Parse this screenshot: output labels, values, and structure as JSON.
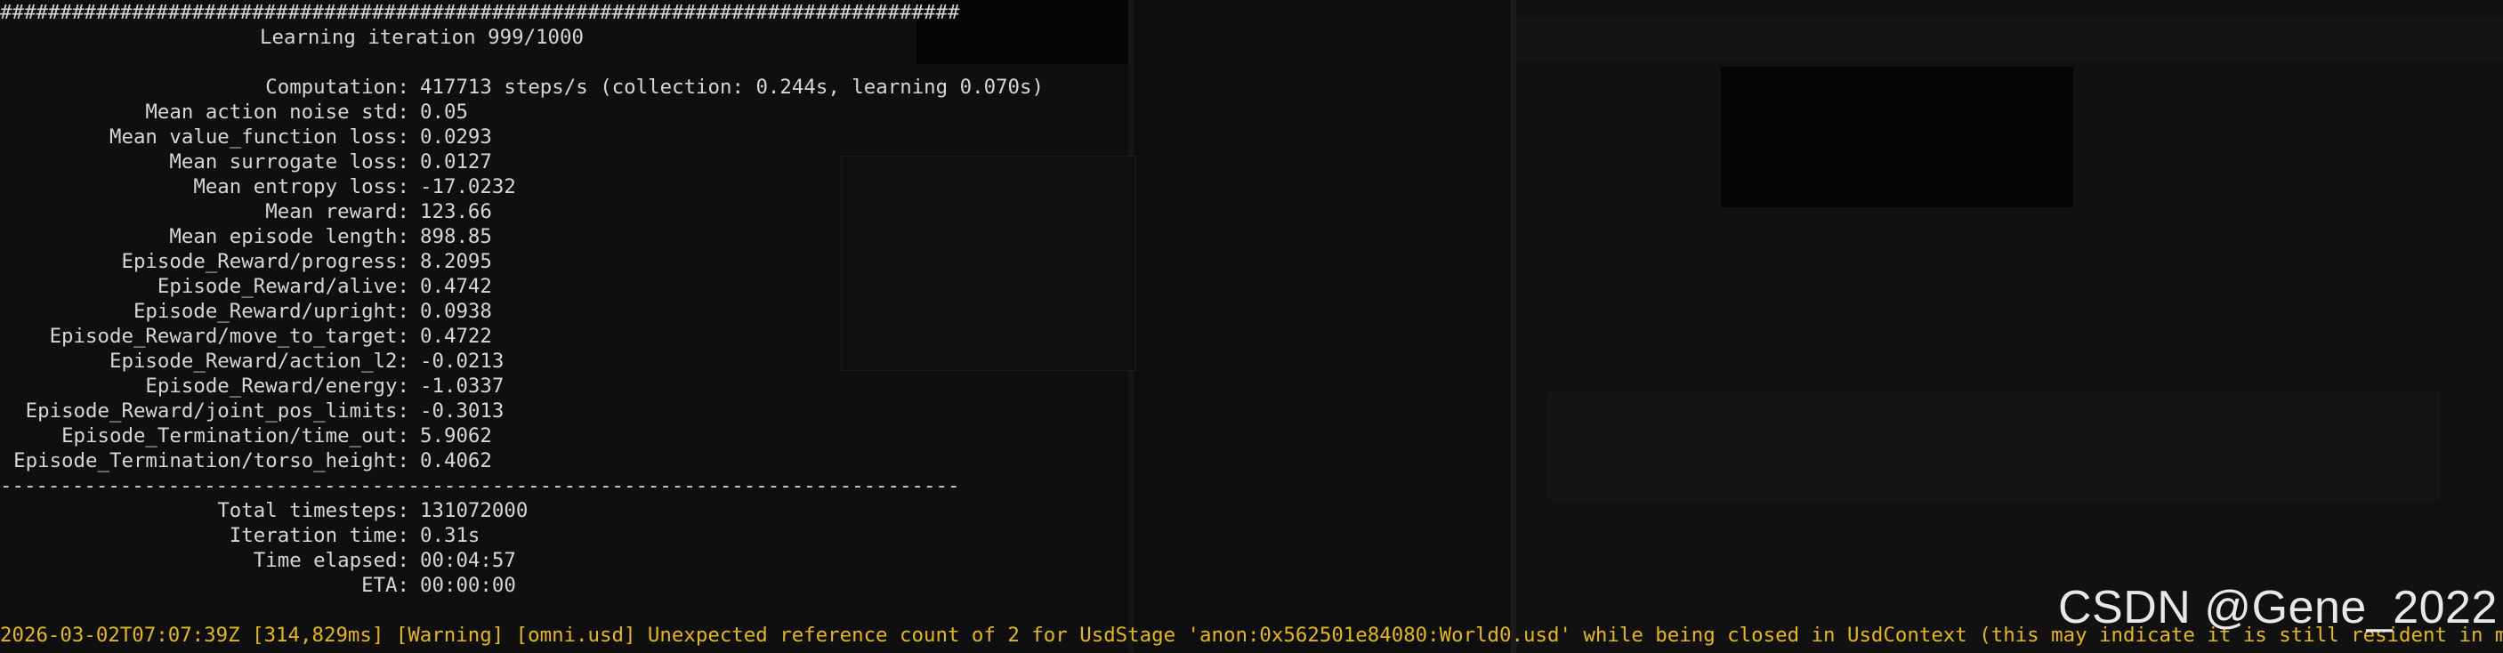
{
  "terminal": {
    "hash_rule": "################################################################################",
    "iteration_header": "Learning iteration 999/1000",
    "metrics": [
      {
        "key": "Computation:",
        "value": "417713 steps/s (collection: 0.244s, learning 0.070s)"
      },
      {
        "key": "Mean action noise std:",
        "value": "0.05"
      },
      {
        "key": "Mean value_function loss:",
        "value": "0.0293"
      },
      {
        "key": "Mean surrogate loss:",
        "value": "0.0127"
      },
      {
        "key": "Mean entropy loss:",
        "value": "-17.0232"
      },
      {
        "key": "Mean reward:",
        "value": "123.66"
      },
      {
        "key": "Mean episode length:",
        "value": "898.85"
      },
      {
        "key": "Episode_Reward/progress:",
        "value": "8.2095"
      },
      {
        "key": "Episode_Reward/alive:",
        "value": "0.4742"
      },
      {
        "key": "Episode_Reward/upright:",
        "value": "0.0938"
      },
      {
        "key": "Episode_Reward/move_to_target:",
        "value": "0.4722"
      },
      {
        "key": "Episode_Reward/action_l2:",
        "value": "-0.0213"
      },
      {
        "key": "Episode_Reward/energy:",
        "value": "-1.0337"
      },
      {
        "key": "Episode_Reward/joint_pos_limits:",
        "value": "-0.3013"
      },
      {
        "key": "Episode_Termination/time_out:",
        "value": "5.9062"
      },
      {
        "key": "Episode_Termination/torso_height:",
        "value": "0.4062"
      }
    ],
    "dash_rule": "--------------------------------------------------------------------------------",
    "summary": [
      {
        "key": "Total timesteps:",
        "value": "131072000"
      },
      {
        "key": "Iteration time:",
        "value": "0.31s"
      },
      {
        "key": "Time elapsed:",
        "value": "00:04:57"
      },
      {
        "key": "ETA:",
        "value": "00:00:00"
      }
    ],
    "warning_line": "2026-03-02T07:07:39Z [314,829ms] [Warning] [omni.usd] Unexpected reference count of 2 for UsdStage 'anon:0x562501e84080:World0.usd' while being closed in UsdContext (this may indicate it is still resident in memory)."
  },
  "watermark": "CSDN @Gene_2022",
  "colors": {
    "background": "#0c0c0c",
    "text": "#d6d6d6",
    "warning": "#e5b810",
    "watermark": "#e8e8e8"
  }
}
